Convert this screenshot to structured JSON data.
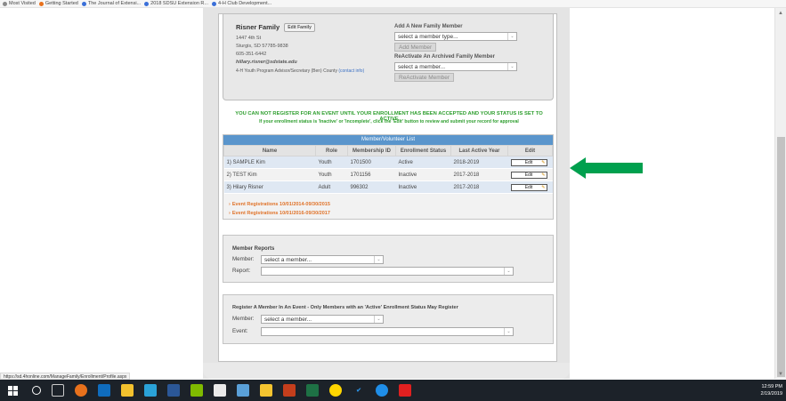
{
  "browser": {
    "bookmarks": [
      {
        "label": "Most Visited",
        "icon": "gear-icon",
        "color": "#8a8a8a"
      },
      {
        "label": "Getting Started",
        "icon": "firefox-icon",
        "color": "#e8711c"
      },
      {
        "label": "The Journal of Extensi...",
        "icon": "globe-icon",
        "color": "#3a6fd8"
      },
      {
        "label": "2018 SDSU Extension R...",
        "icon": "globe-icon",
        "color": "#3a6fd8"
      },
      {
        "label": "4-H Club Development...",
        "icon": "globe-icon",
        "color": "#3a6fd8"
      }
    ],
    "status_url": "https://sd.4honline.com/ManageFamily/Enrollment/Profile.aspx"
  },
  "family": {
    "name": "Risner Family",
    "edit_family_label": "Edit Family",
    "address1": "1447 4th St",
    "address2": "Sturgis, SD 57785-9838",
    "phone": "605-351-6442",
    "email": "hillary.risner@sdstate.edu",
    "advisor_line": "4-H Youth Program Advisor/Secretary (Ben) County",
    "contact_info_label": "(contact info)"
  },
  "add_member": {
    "title": "Add A New Family Member",
    "select_value": "select a member type...",
    "button_label": "Add Member"
  },
  "reactivate": {
    "title": "ReActivate An Archived Family Member",
    "select_value": "select a member...",
    "button_label": "ReActivate Member"
  },
  "warning": {
    "line1": "YOU CAN NOT REGISTER FOR AN EVENT UNTIL YOUR ENROLLMENT HAS BEEN ACCEPTED AND YOUR STATUS IS SET TO ACTIVE",
    "line2": "If your enrollment status is 'Inactive' or 'Incomplete', click the 'Edit' button to review and submit your record for approval"
  },
  "member_list": {
    "title": "Member/Volunteer List",
    "columns": [
      "Name",
      "Role",
      "Membership ID",
      "Enrollment Status",
      "Last Active Year",
      "Edit"
    ],
    "rows": [
      {
        "num": "1)",
        "name": "SAMPLE Kim",
        "role": "Youth",
        "id": "1701500",
        "status": "Active",
        "year": "2018-2019",
        "edit": "Edit"
      },
      {
        "num": "2)",
        "name": "TEST Kim",
        "role": "Youth",
        "id": "1701156",
        "status": "Inactive",
        "year": "2017-2018",
        "edit": "Edit"
      },
      {
        "num": "3)",
        "name": "Hilary Risner",
        "role": "Adult",
        "id": "996302",
        "status": "Inactive",
        "year": "2017-2018",
        "edit": "Edit"
      }
    ],
    "event_links": [
      "Event Registrations 10/01/2014-09/30/2015",
      "Event Registrations 10/01/2016-09/30/2017"
    ]
  },
  "member_reports": {
    "title": "Member Reports",
    "member_label": "Member:",
    "member_value": "select a member...",
    "report_label": "Report:",
    "report_value": ""
  },
  "register_event": {
    "title": "Register A Member In An Event - Only Members with an 'Active' Enrollment Status May Register",
    "member_label": "Member:",
    "member_value": "select a member...",
    "event_label": "Event:",
    "event_value": ""
  },
  "taskbar": {
    "time": "12:59 PM",
    "date": "2/19/2019"
  },
  "colors": {
    "list_header": "#5a95cc",
    "warning_green": "#2e9e2e",
    "event_link_orange": "#e0732a",
    "annotation_arrow": "#00a04e"
  }
}
